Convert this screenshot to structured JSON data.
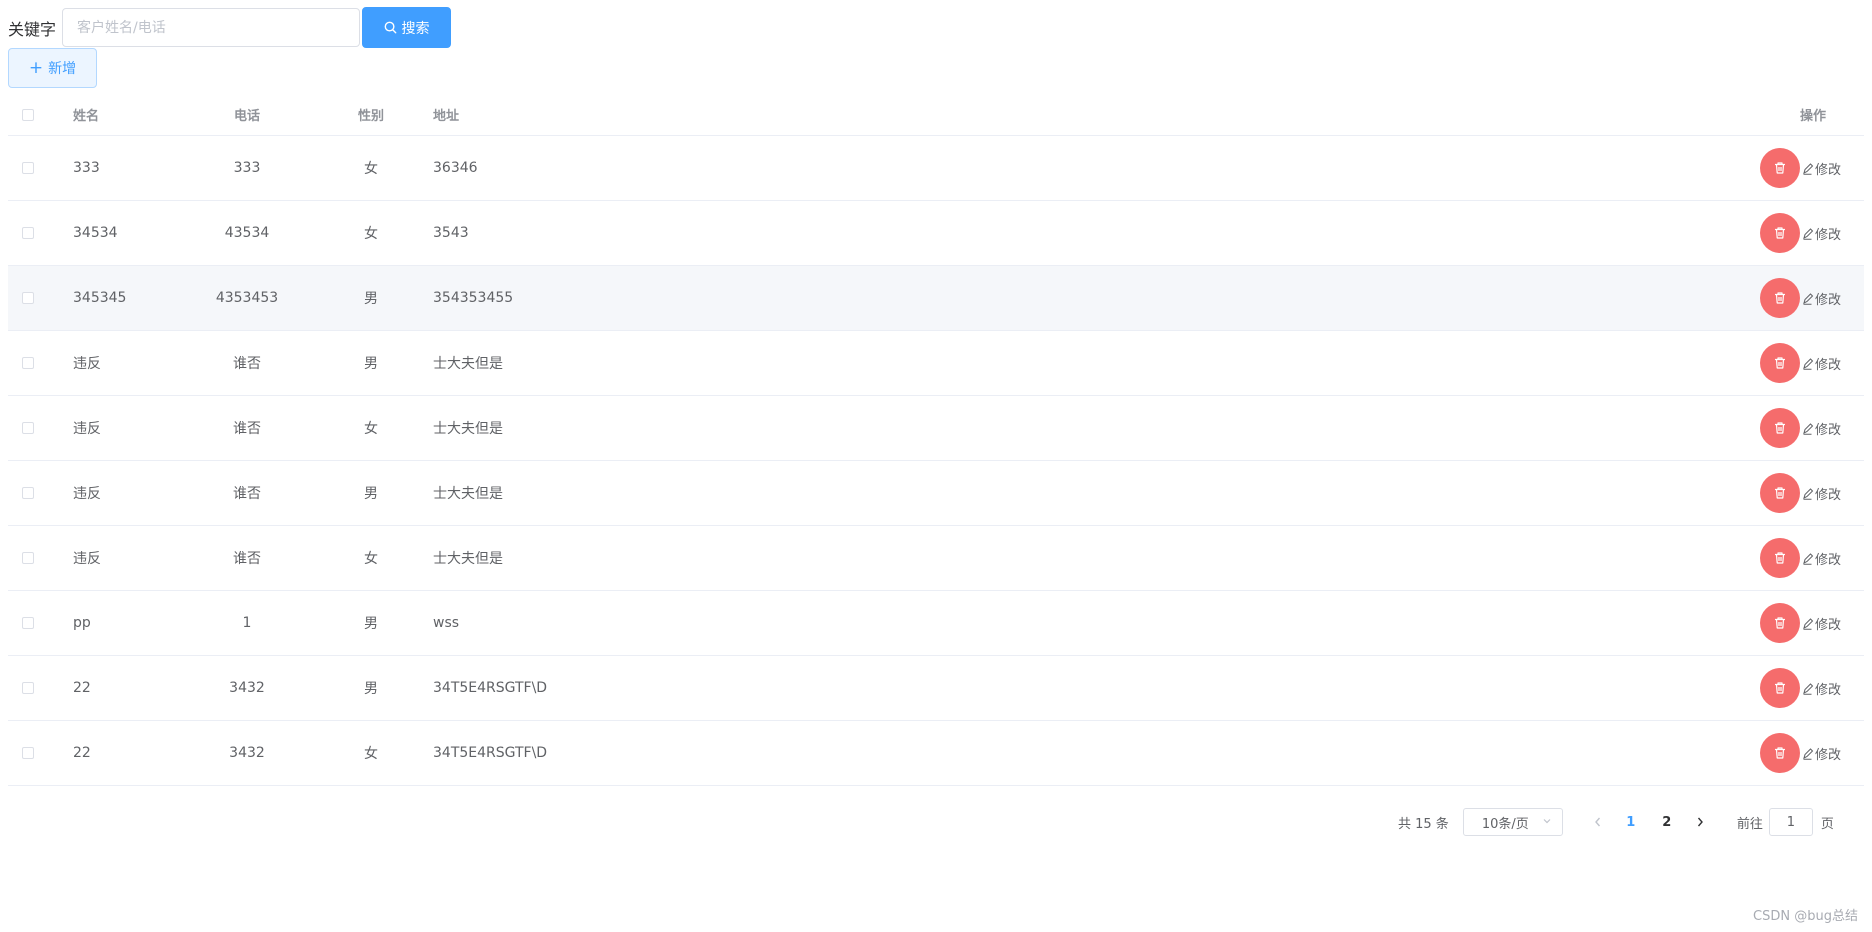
{
  "search": {
    "label": "关键字",
    "placeholder": "客户姓名/电话",
    "value": "",
    "button_label": "搜索",
    "button_icon": "search-icon"
  },
  "toolbar": {
    "add_label": "新增",
    "add_icon": "plus-icon"
  },
  "table": {
    "columns": {
      "name": "姓名",
      "phone": "电话",
      "gender": "性别",
      "address": "地址",
      "ops": "操作"
    },
    "rows": [
      {
        "name": "333",
        "phone": "333",
        "gender": "女",
        "address": "36346"
      },
      {
        "name": "34534",
        "phone": "43534",
        "gender": "女",
        "address": "3543"
      },
      {
        "name": "345345",
        "phone": "4353453",
        "gender": "男",
        "address": "354353455"
      },
      {
        "name": "违反",
        "phone": "谁否",
        "gender": "男",
        "address": "士大夫但是"
      },
      {
        "name": "违反",
        "phone": "谁否",
        "gender": "女",
        "address": "士大夫但是"
      },
      {
        "name": "违反",
        "phone": "谁否",
        "gender": "男",
        "address": "士大夫但是"
      },
      {
        "name": "违反",
        "phone": "谁否",
        "gender": "女",
        "address": "士大夫但是"
      },
      {
        "name": "pp",
        "phone": "1",
        "gender": "男",
        "address": "wss"
      },
      {
        "name": "22",
        "phone": "3432",
        "gender": "男",
        "address": "34T5E4RSGTF\\D"
      },
      {
        "name": "22",
        "phone": "3432",
        "gender": "女",
        "address": "34T5E4RSGTF\\D"
      }
    ],
    "edit_label": "修改",
    "delete_icon": "trash-icon",
    "edit_icon": "edit-icon"
  },
  "pagination": {
    "total_text": "共 15 条",
    "page_size": "10条/页",
    "pages": [
      "1",
      "2"
    ],
    "current_page": "1",
    "goto_label": "前往",
    "goto_value": "1",
    "page_suffix": "页"
  },
  "watermark": "CSDN @bug总结",
  "colors": {
    "primary": "#409eff",
    "danger": "#f56c6c",
    "border": "#ebeef5",
    "row_hover": "#f5f7fa"
  }
}
